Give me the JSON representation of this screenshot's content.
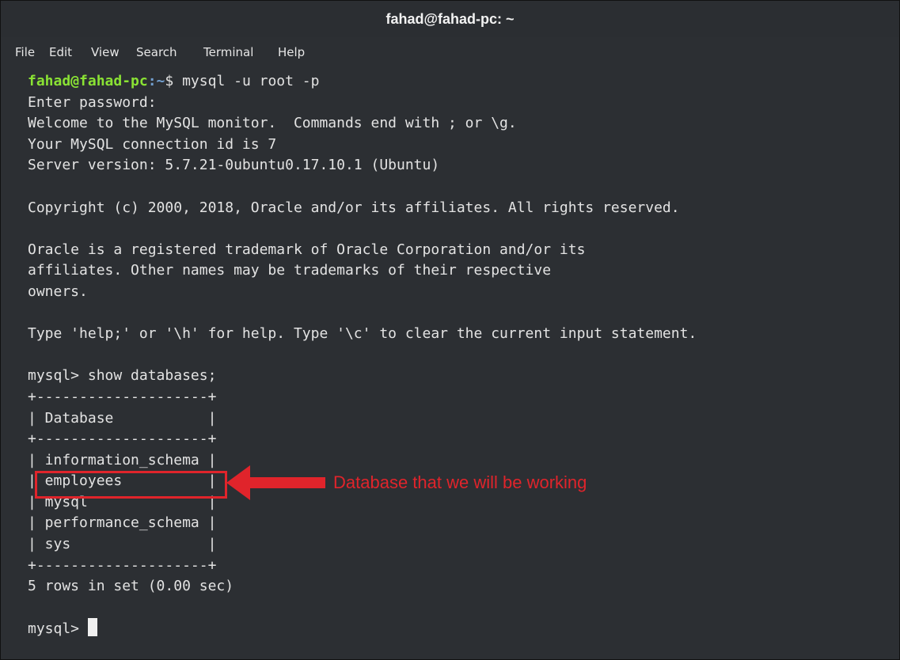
{
  "window": {
    "title": "fahad@fahad-pc: ~"
  },
  "menu": {
    "file": "File",
    "edit": "Edit",
    "view": "View",
    "search": "Search",
    "terminal": "Terminal",
    "help": "Help"
  },
  "terminal": {
    "prompt_user": "fahad@fahad-pc",
    "prompt_path": ":~",
    "prompt_symbol": "$ ",
    "command": "mysql -u root -p",
    "lines": [
      "Enter password:",
      "Welcome to the MySQL monitor.  Commands end with ; or \\g.",
      "Your MySQL connection id is 7",
      "Server version: 5.7.21-0ubuntu0.17.10.1 (Ubuntu)",
      "",
      "Copyright (c) 2000, 2018, Oracle and/or its affiliates. All rights reserved.",
      "",
      "Oracle is a registered trademark of Oracle Corporation and/or its",
      "affiliates. Other names may be trademarks of their respective",
      "owners.",
      "",
      "Type 'help;' or '\\h' for help. Type '\\c' to clear the current input statement.",
      "",
      "mysql> show databases;",
      "+--------------------+",
      "| Database           |",
      "+--------------------+",
      "| information_schema |",
      "| employees          |",
      "| mysql              |",
      "| performance_schema |",
      "| sys                |",
      "+--------------------+",
      "5 rows in set (0.00 sec)",
      ""
    ],
    "final_prompt": "mysql> "
  },
  "annotation": {
    "text": "Database that we will be working",
    "color": "#e0242b"
  }
}
